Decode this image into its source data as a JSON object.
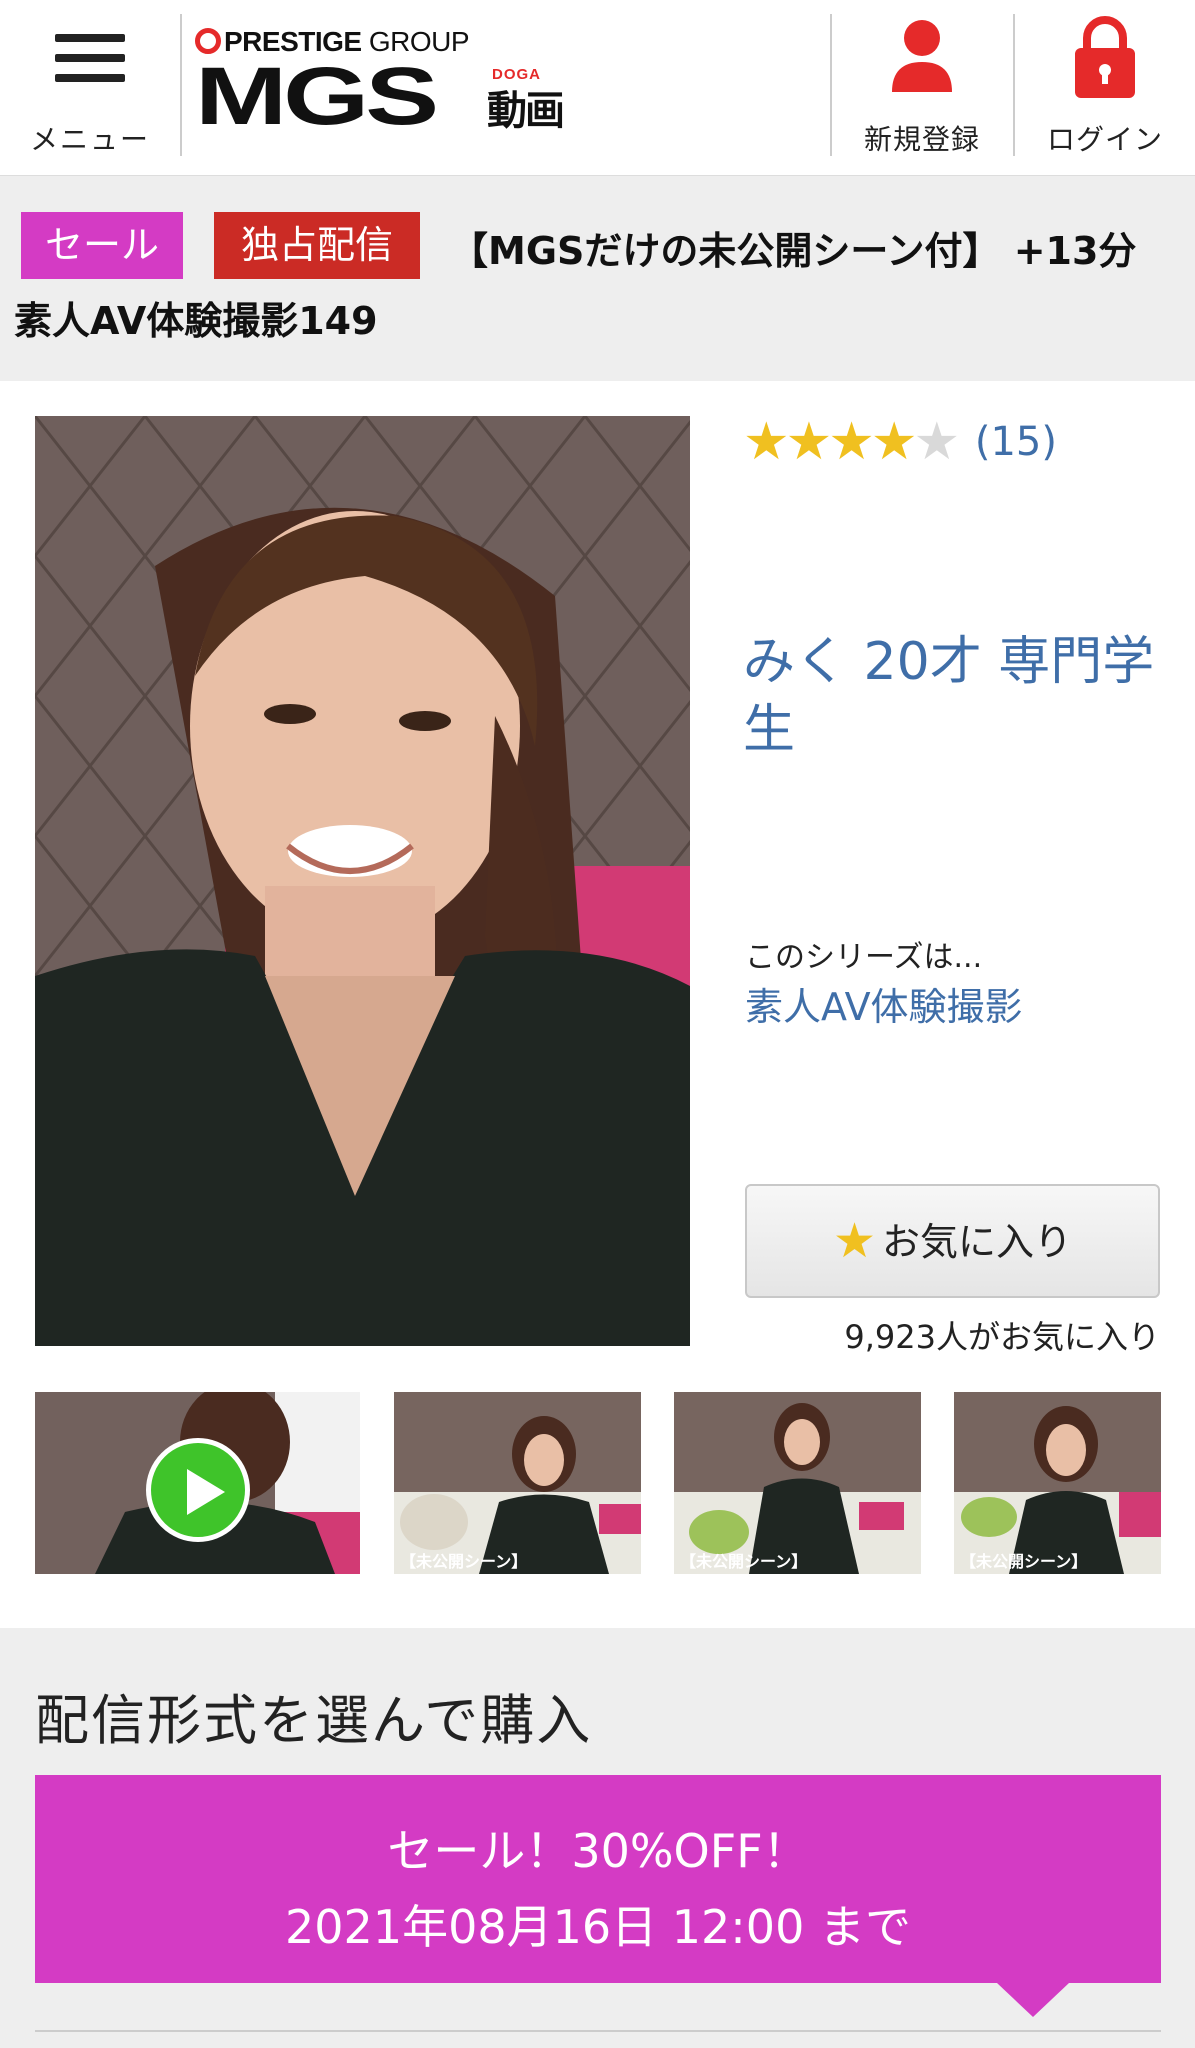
{
  "header": {
    "menu_label": "メニュー",
    "logo": {
      "group_brand": "PRESTIGE",
      "group_suffix": "GROUP",
      "brand_mgs": "MGS",
      "brand_doga": "DOGA",
      "brand_doga_kanji": "動画"
    },
    "register_label": "新規登録",
    "login_label": "ログイン"
  },
  "product": {
    "badges": [
      "セール",
      "独占配信"
    ],
    "title": "【MGSだけの未公開シーン付】 +13分 素人AV体験撮影149",
    "rating": {
      "stars": 4,
      "max": 5,
      "count_text": "(15)"
    },
    "actress": "みく 20才 専門学生",
    "series_intro": "このシリーズは...",
    "series_link": "素人AV体験撮影",
    "favorite_button": "お気に入り",
    "favorite_count": "9,923人がお気に入り",
    "thumbnails": [
      {
        "caption": ""
      },
      {
        "caption": "【未公開シーン】"
      },
      {
        "caption": "【未公開シーン】"
      },
      {
        "caption": "【未公開シーン】"
      }
    ]
  },
  "purchase": {
    "heading": "配信形式を選んで購入",
    "sale_line1": "セール！30%OFF！",
    "sale_line2": "2021年08月16日 12:00 まで"
  },
  "colors": {
    "sale_pink": "#d43bc4",
    "exclusive_red": "#cb2b25",
    "link_blue": "#3f6ea8",
    "star_gold": "#f0c020",
    "play_green": "#3fc42a"
  }
}
